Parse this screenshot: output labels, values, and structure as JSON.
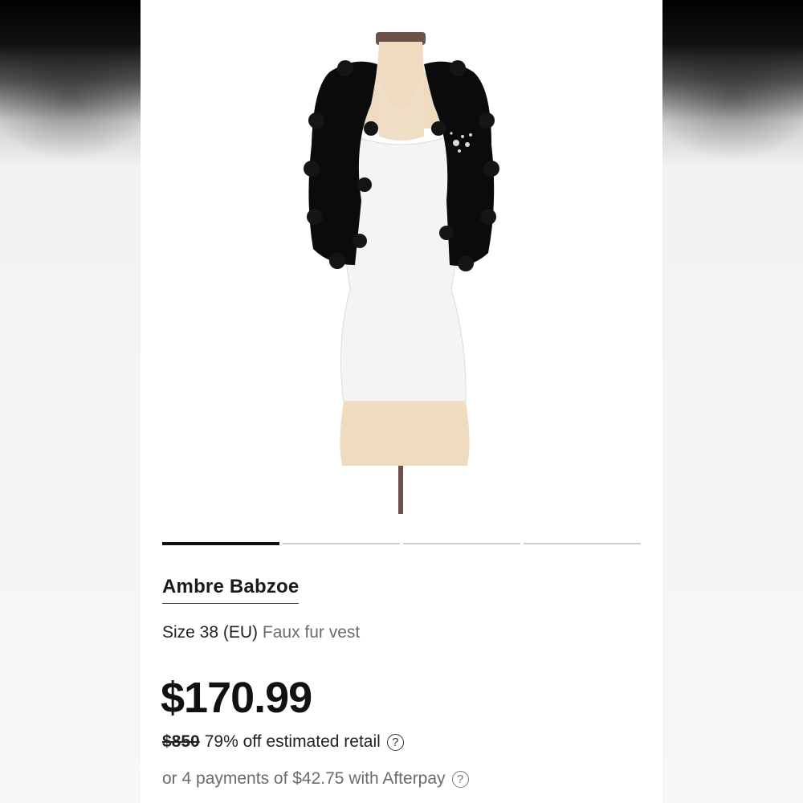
{
  "product": {
    "brand": "Ambre Babzoe",
    "size": "Size 38 (EU)",
    "type": "Faux fur vest",
    "price": "$170.99",
    "retail_price": "$850",
    "discount_text": "79% off estimated retail",
    "afterpay_text": "or 4 payments of $42.75 with Afterpay"
  },
  "carousel": {
    "count": 4,
    "active_index": 0
  },
  "icons": {
    "help": "?"
  }
}
